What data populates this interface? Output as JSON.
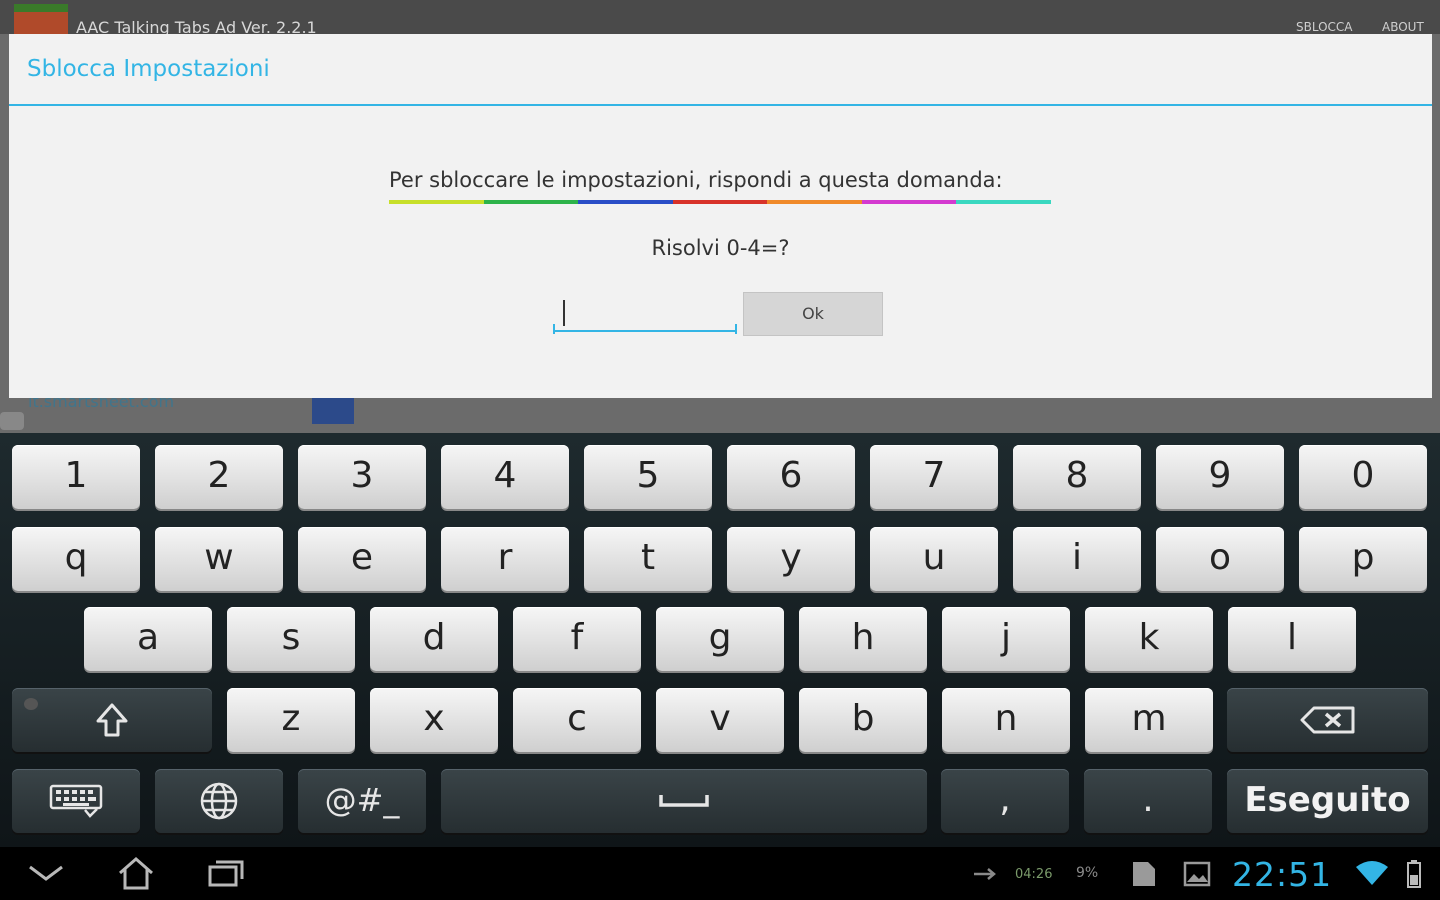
{
  "background": {
    "app_title": "AAC Talking Tabs Ad Ver. 2.2.1",
    "header_right_1": "SBLOCCA",
    "header_right_2": "ABOUT",
    "ad_link": "it.smartsheet.com"
  },
  "dialog": {
    "title": "Sblocca Impostazioni",
    "question": "Per sbloccare le impostazioni, rispondi a questa domanda:",
    "problem": "Risolvi 0-4=?",
    "answer_value": "",
    "answer_placeholder": "",
    "ok_label": "Ok",
    "rainbow_colors": [
      "#c7df2a",
      "#2db34a",
      "#2a4ec7",
      "#d8332a",
      "#f08a2a",
      "#d43ad0",
      "#3ad8c0"
    ]
  },
  "keyboard": {
    "row1": [
      "1",
      "2",
      "3",
      "4",
      "5",
      "6",
      "7",
      "8",
      "9",
      "0"
    ],
    "row2": [
      "q",
      "w",
      "e",
      "r",
      "t",
      "y",
      "u",
      "i",
      "o",
      "p"
    ],
    "row3": [
      "a",
      "s",
      "d",
      "f",
      "g",
      "h",
      "j",
      "k",
      "l"
    ],
    "row4": [
      "z",
      "x",
      "c",
      "v",
      "b",
      "n",
      "m"
    ],
    "symbols_label": "@#_",
    "comma_label": ",",
    "period_label": ".",
    "done_label": "Eseguito",
    "icons": {
      "shift": "shift-icon",
      "backspace": "backspace-icon",
      "keyboard": "keyboard-settings-icon",
      "globe": "globe-icon",
      "space": "space-icon"
    }
  },
  "navbar": {
    "clock": "22:51",
    "data_counter": "04:26",
    "battery_text": "9%",
    "accent_color": "#33b5e5",
    "icons": [
      "back-icon",
      "home-icon",
      "recent-apps-icon",
      "usb-icon",
      "sd-card-icon",
      "image-icon",
      "wifi-icon",
      "battery-icon"
    ]
  }
}
